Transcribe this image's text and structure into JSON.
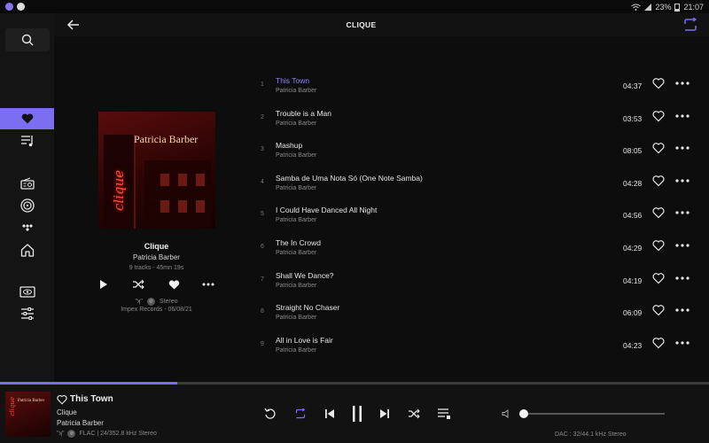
{
  "status_bar": {
    "battery": "23%",
    "time": "21:07"
  },
  "header": {
    "title": "CLIQUE"
  },
  "album": {
    "title": "Clique",
    "artist": "Patricia Barber",
    "meta": "9 tracks - 45mn 19s",
    "quality_badge": "Stereo",
    "label": "Impex Records - 06/08/21",
    "cover_artist_text": "Patricia Barber",
    "cover_neon_text": "clique"
  },
  "tracks": [
    {
      "num": "1",
      "title": "This Town",
      "artist": "Patricia Barber",
      "duration": "04:37",
      "playing": true
    },
    {
      "num": "2",
      "title": "Trouble is a Man",
      "artist": "Patricia Barber",
      "duration": "03:53"
    },
    {
      "num": "3",
      "title": "Mashup",
      "artist": "Patricia Barber",
      "duration": "08:05"
    },
    {
      "num": "4",
      "title": "Samba de Uma Nota Só (One Note Samba)",
      "artist": "Patricia Barber",
      "duration": "04:28"
    },
    {
      "num": "5",
      "title": "I Could Have Danced All Night",
      "artist": "Patricia Barber",
      "duration": "04:56"
    },
    {
      "num": "6",
      "title": "The In Crowd",
      "artist": "Patricia Barber",
      "duration": "04:29"
    },
    {
      "num": "7",
      "title": "Shall We Dance?",
      "artist": "Patricia Barber",
      "duration": "04:19"
    },
    {
      "num": "8",
      "title": "Straight No Chaser",
      "artist": "Patricia Barber",
      "duration": "06:09"
    },
    {
      "num": "9",
      "title": "All in Love is Fair",
      "artist": "Patricia Barber",
      "duration": "04:23"
    }
  ],
  "now_playing": {
    "title": "This Town",
    "album": "Clique",
    "artist": "Patricia Barber",
    "quality": "FLAC | 24/352.8 kHz Stereo",
    "progress": 0.25,
    "volume": 0.0,
    "dac": "DAC : 32/44.1 kHz Stereo"
  },
  "colors": {
    "accent": "#7b6ef0",
    "playing_text": "#8f82ff",
    "background": "#0d0d0d"
  }
}
